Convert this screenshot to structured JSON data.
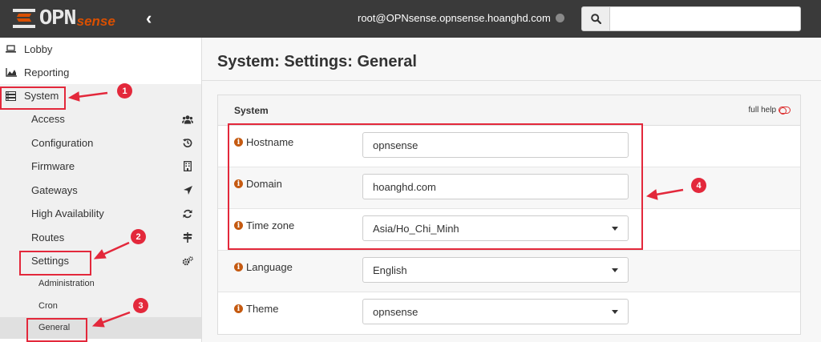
{
  "header": {
    "logo_text": "OPN",
    "logo_sense": "sense",
    "user": "root@OPNsense.opnsense.hoanghd.com",
    "search_placeholder": ""
  },
  "sidebar": {
    "top_items": [
      {
        "label": "Lobby",
        "icon": "laptop-icon"
      },
      {
        "label": "Reporting",
        "icon": "area-chart-icon"
      },
      {
        "label": "System",
        "icon": "server-icon"
      }
    ],
    "system_items": [
      {
        "label": "Access",
        "icon": "users-icon"
      },
      {
        "label": "Configuration",
        "icon": "history-icon"
      },
      {
        "label": "Firmware",
        "icon": "building-icon"
      },
      {
        "label": "Gateways",
        "icon": "location-arrow-icon"
      },
      {
        "label": "High Availability",
        "icon": "refresh-icon"
      },
      {
        "label": "Routes",
        "icon": "map-signs-icon"
      },
      {
        "label": "Settings",
        "icon": "cogs-icon"
      }
    ],
    "settings_items": [
      "Administration",
      "Cron",
      "General"
    ]
  },
  "main": {
    "title": "System: Settings: General",
    "panel_title": "System",
    "full_help": "full help",
    "fields": [
      {
        "label": "Hostname",
        "value": "opnsense",
        "type": "text"
      },
      {
        "label": "Domain",
        "value": "hoanghd.com",
        "type": "text"
      },
      {
        "label": "Time zone",
        "value": "Asia/Ho_Chi_Minh",
        "type": "select"
      },
      {
        "label": "Language",
        "value": "English",
        "type": "select"
      },
      {
        "label": "Theme",
        "value": "opnsense",
        "type": "select"
      }
    ]
  },
  "annotations": {
    "badges": [
      "1",
      "2",
      "3",
      "4"
    ]
  },
  "colors": {
    "topbar": "#3a3a3a",
    "brand_orange": "#d94f00",
    "annotation_red": "#e3283b"
  }
}
